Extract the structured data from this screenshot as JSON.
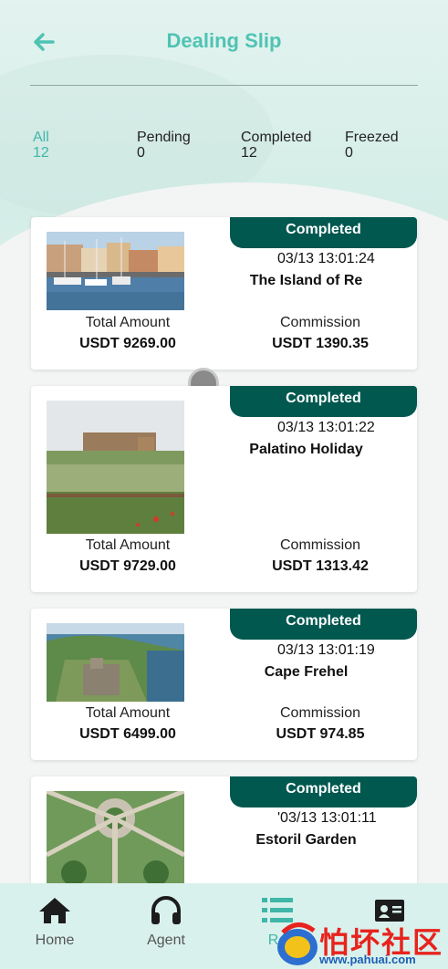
{
  "header": {
    "title": "Dealing Slip",
    "back_icon": "arrow-left-icon"
  },
  "tabs": [
    {
      "label": "All",
      "count": "12",
      "active": true
    },
    {
      "label": "Pending",
      "count": "0",
      "active": false
    },
    {
      "label": "Completed",
      "count": "12",
      "active": false
    },
    {
      "label": "Freezed",
      "count": "0",
      "active": false
    }
  ],
  "orders": [
    {
      "status": "Completed",
      "time": "03/13 13:01:24",
      "name": "The Island of Re",
      "total_label": "Total Amount",
      "total_value": "USDT 9269.00",
      "commission_label": "Commission",
      "commission_value": "USDT 1390.35"
    },
    {
      "status": "Completed",
      "time": "03/13 13:01:22",
      "name": "Palatino Holiday",
      "total_label": "Total Amount",
      "total_value": "USDT 9729.00",
      "commission_label": "Commission",
      "commission_value": "USDT 1313.42"
    },
    {
      "status": "Completed",
      "time": "03/13 13:01:19",
      "name": "Cape Frehel",
      "total_label": "Total Amount",
      "total_value": "USDT 6499.00",
      "commission_label": "Commission",
      "commission_value": "USDT 974.85"
    },
    {
      "status": "Completed",
      "time": "'03/13 13:01:11",
      "name": "Estoril Garden"
    }
  ],
  "bottom_nav": [
    {
      "label": "Home",
      "icon": "home-icon"
    },
    {
      "label": "Agent",
      "icon": "headphones-icon"
    },
    {
      "label": "Re",
      "icon": "list-icon",
      "active": true
    },
    {
      "label": "",
      "icon": "id-card-icon"
    }
  ],
  "watermark": {
    "text": "怕坏社区",
    "url": "www.pahuai.com"
  },
  "colors": {
    "accent": "#4fc3b3",
    "badge": "#00584f",
    "nav_bg": "#d9f1ec"
  }
}
